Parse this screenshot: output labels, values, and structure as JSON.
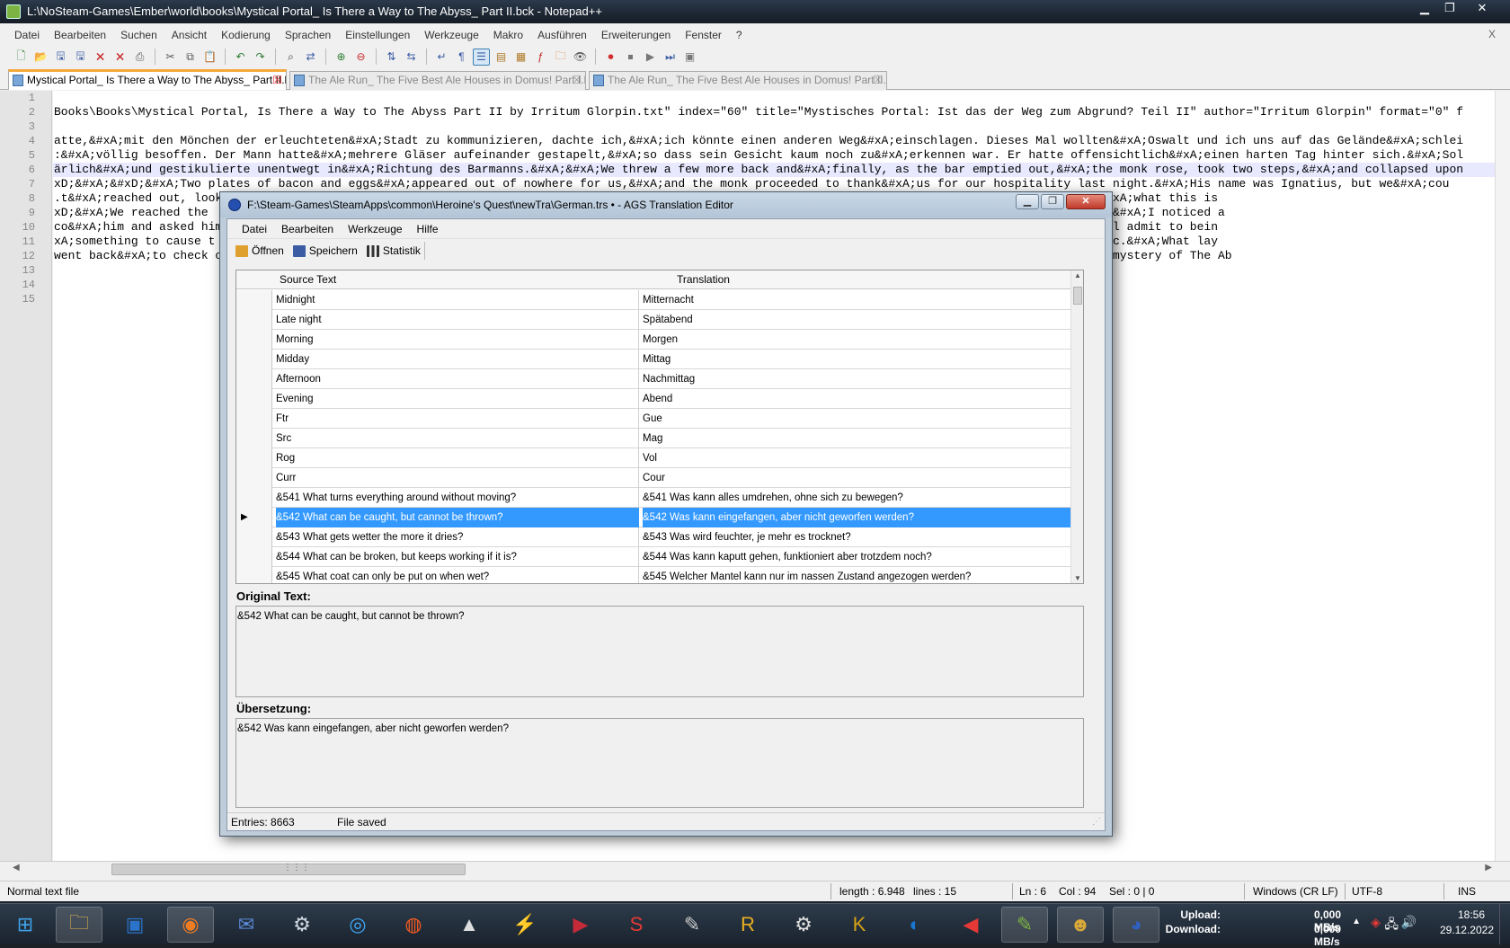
{
  "npp": {
    "title": "L:\\NoSteam-Games\\Ember\\world\\books\\Mystical Portal_ Is There a Way to The Abyss_ Part II.bck - Notepad++",
    "menu": [
      "Datei",
      "Bearbeiten",
      "Suchen",
      "Ansicht",
      "Kodierung",
      "Sprachen",
      "Einstellungen",
      "Werkzeuge",
      "Makro",
      "Ausführen",
      "Erweiterungen",
      "Fenster",
      "?"
    ],
    "menu_close": "X",
    "tabs": [
      "Mystical Portal_ Is There a Way to The Abyss_ Part II.bck",
      "The Ale Run_ The Five Best Ale Houses in Domus! Part I.bck",
      "The Ale Run_ The Five Best Ale Houses in Domus! Part II.bck"
    ],
    "line_numbers": [
      "1",
      "2",
      "3",
      "4",
      "5",
      "6",
      "7",
      "8",
      "9",
      "10",
      "11",
      "12",
      "13",
      "14",
      "15"
    ],
    "lines": [
      "",
      "Books\\Books\\Mystical Portal, Is There a Way to The Abyss Part II by Irritum Glorpin.txt\" index=\"60\" title=\"Mystisches Portal: Ist das der Weg zum Abgrund? Teil II\" author=\"Irritum Glorpin\" format=\"0\" f",
      "",
      "atte,&#xA;mit den Mönchen der erleuchteten&#xA;Stadt zu kommunizieren, dachte ich,&#xA;ich könnte einen anderen Weg&#xA;einschlagen. Dieses Mal wollten&#xA;Oswalt und ich uns auf das Gelände&#xA;schlei",
      ":&#xA;völlig besoffen. Der Mann hatte&#xA;mehrere Gläser aufeinander gestapelt,&#xA;so dass sein Gesicht kaum noch zu&#xA;erkennen war. Er hatte offensichtlich&#xA;einen harten Tag hinter sich.&#xA;Sol",
      "ärlich&#xA;und gestikulierte unentwegt in&#xA;Richtung des Barmanns.&#xA;&#xA;We threw a few more back and&#xA;finally, as the bar emptied out,&#xA;the monk rose, took two steps,&#xA;and collapsed upon",
      "xD;&#xA;&#xD;&#xA;Two plates of bacon and eggs&#xA;appeared out of nowhere for us,&#xA;and the monk proceeded to thank&#xA;us for our hospitality last night.&#xA;His name was Ignatius, but we&#xA;cou",
      ".t&#xA;reached out, look                                                                                         uot;I...I think I understand. I know&#xA;what this is",
      "xD;&#xA;We reached the                                                                                           &#xA;over and began shouting, but then&#xA;I noticed a",
      "co&#xA;him and asked him                                                                                         ared. Oswalt let out a&#xA;shriek. I'll admit to bein",
      "xA;something to cause t                                                                                          oor&#xA;opened. All of us were ecstatic.&#xA;What lay",
      "went back&#xA;to check o                                                                                         &#xA;Our chance at uncovering the&#xA;mystery of The Ab",
      "",
      "",
      ""
    ],
    "status": {
      "type": "Normal text file",
      "length": "length : 6.948",
      "lines": "lines : 15",
      "ln": "Ln : 6",
      "col": "Col : 94",
      "sel": "Sel : 0 | 0",
      "eol": "Windows (CR LF)",
      "encoding": "UTF-8",
      "mode": "INS"
    }
  },
  "ags": {
    "title": "F:\\Steam-Games\\SteamApps\\common\\Heroine's Quest\\newTra\\German.trs • - AGS Translation Editor",
    "menu": [
      "Datei",
      "Bearbeiten",
      "Werkzeuge",
      "Hilfe"
    ],
    "toolbar": {
      "open": "Öffnen",
      "save": "Speichern",
      "stats": "Statistik"
    },
    "columns": {
      "source": "Source Text",
      "translation": "Translation"
    },
    "rows": [
      {
        "src": "Midnight",
        "tr": "Mitternacht"
      },
      {
        "src": "Late night",
        "tr": "Spätabend"
      },
      {
        "src": "Morning",
        "tr": "Morgen"
      },
      {
        "src": "Midday",
        "tr": "Mittag"
      },
      {
        "src": "Afternoon",
        "tr": "Nachmittag"
      },
      {
        "src": "Evening",
        "tr": "Abend"
      },
      {
        "src": "Ftr",
        "tr": "Gue"
      },
      {
        "src": "Src",
        "tr": "Mag"
      },
      {
        "src": "Rog",
        "tr": "Vol"
      },
      {
        "src": "Curr",
        "tr": "Cour"
      },
      {
        "src": "&541 What turns everything around without moving?",
        "tr": "&541 Was kann alles umdrehen, ohne sich zu bewegen?"
      },
      {
        "src": "&542 What can be caught, but cannot be thrown?",
        "tr": "&542 Was kann eingefangen, aber nicht geworfen werden?",
        "selected": true
      },
      {
        "src": "&543 What gets wetter the more it dries?",
        "tr": "&543 Was wird feuchter, je mehr es trocknet?"
      },
      {
        "src": "&544 What can be broken, but keeps working if it is?",
        "tr": "&544 Was kann kaputt gehen, funktioniert aber trotzdem noch?"
      },
      {
        "src": "&545 What coat can only be put on when wet?",
        "tr": "&545 Welcher Mantel kann nur im nassen Zustand angezogen werden?"
      }
    ],
    "original_label": "Original Text:",
    "original_text": "&542 What can be caught, but cannot be thrown?",
    "translation_label": "Übersetzung:",
    "translation_text": "&542 Was kann eingefangen, aber nicht geworfen werden?",
    "status": {
      "entries": "Entries: 8663",
      "saved": "File saved"
    }
  },
  "taskbar": {
    "icons": [
      "windows-start-icon",
      "file-explorer-icon",
      "id-app-icon",
      "firefox-icon",
      "thunderbird-icon",
      "steam-icon",
      "network-icon",
      "origin-icon",
      "inkscape-icon",
      "winamp-icon",
      "media-player-icon",
      "sg-app-icon",
      "tool-icon",
      "rh-app-icon",
      "settings-gear-icon",
      "kh-app-icon",
      "rainbow-app-icon",
      "speaker-app-icon",
      "notepadpp-icon",
      "character-app-icon",
      "ags-icon"
    ],
    "upload_label": "Upload:",
    "download_label": "Download:",
    "upload_value": "0,000 MB/s",
    "download_value": "0,000 MB/s",
    "time": "18:56",
    "date": "29.12.2022"
  },
  "colors": {
    "selection": "#3399ff",
    "tab_accent": "#f6a93b",
    "dialog_frame": "#bfcddb",
    "taskbar": "#1b2430"
  }
}
